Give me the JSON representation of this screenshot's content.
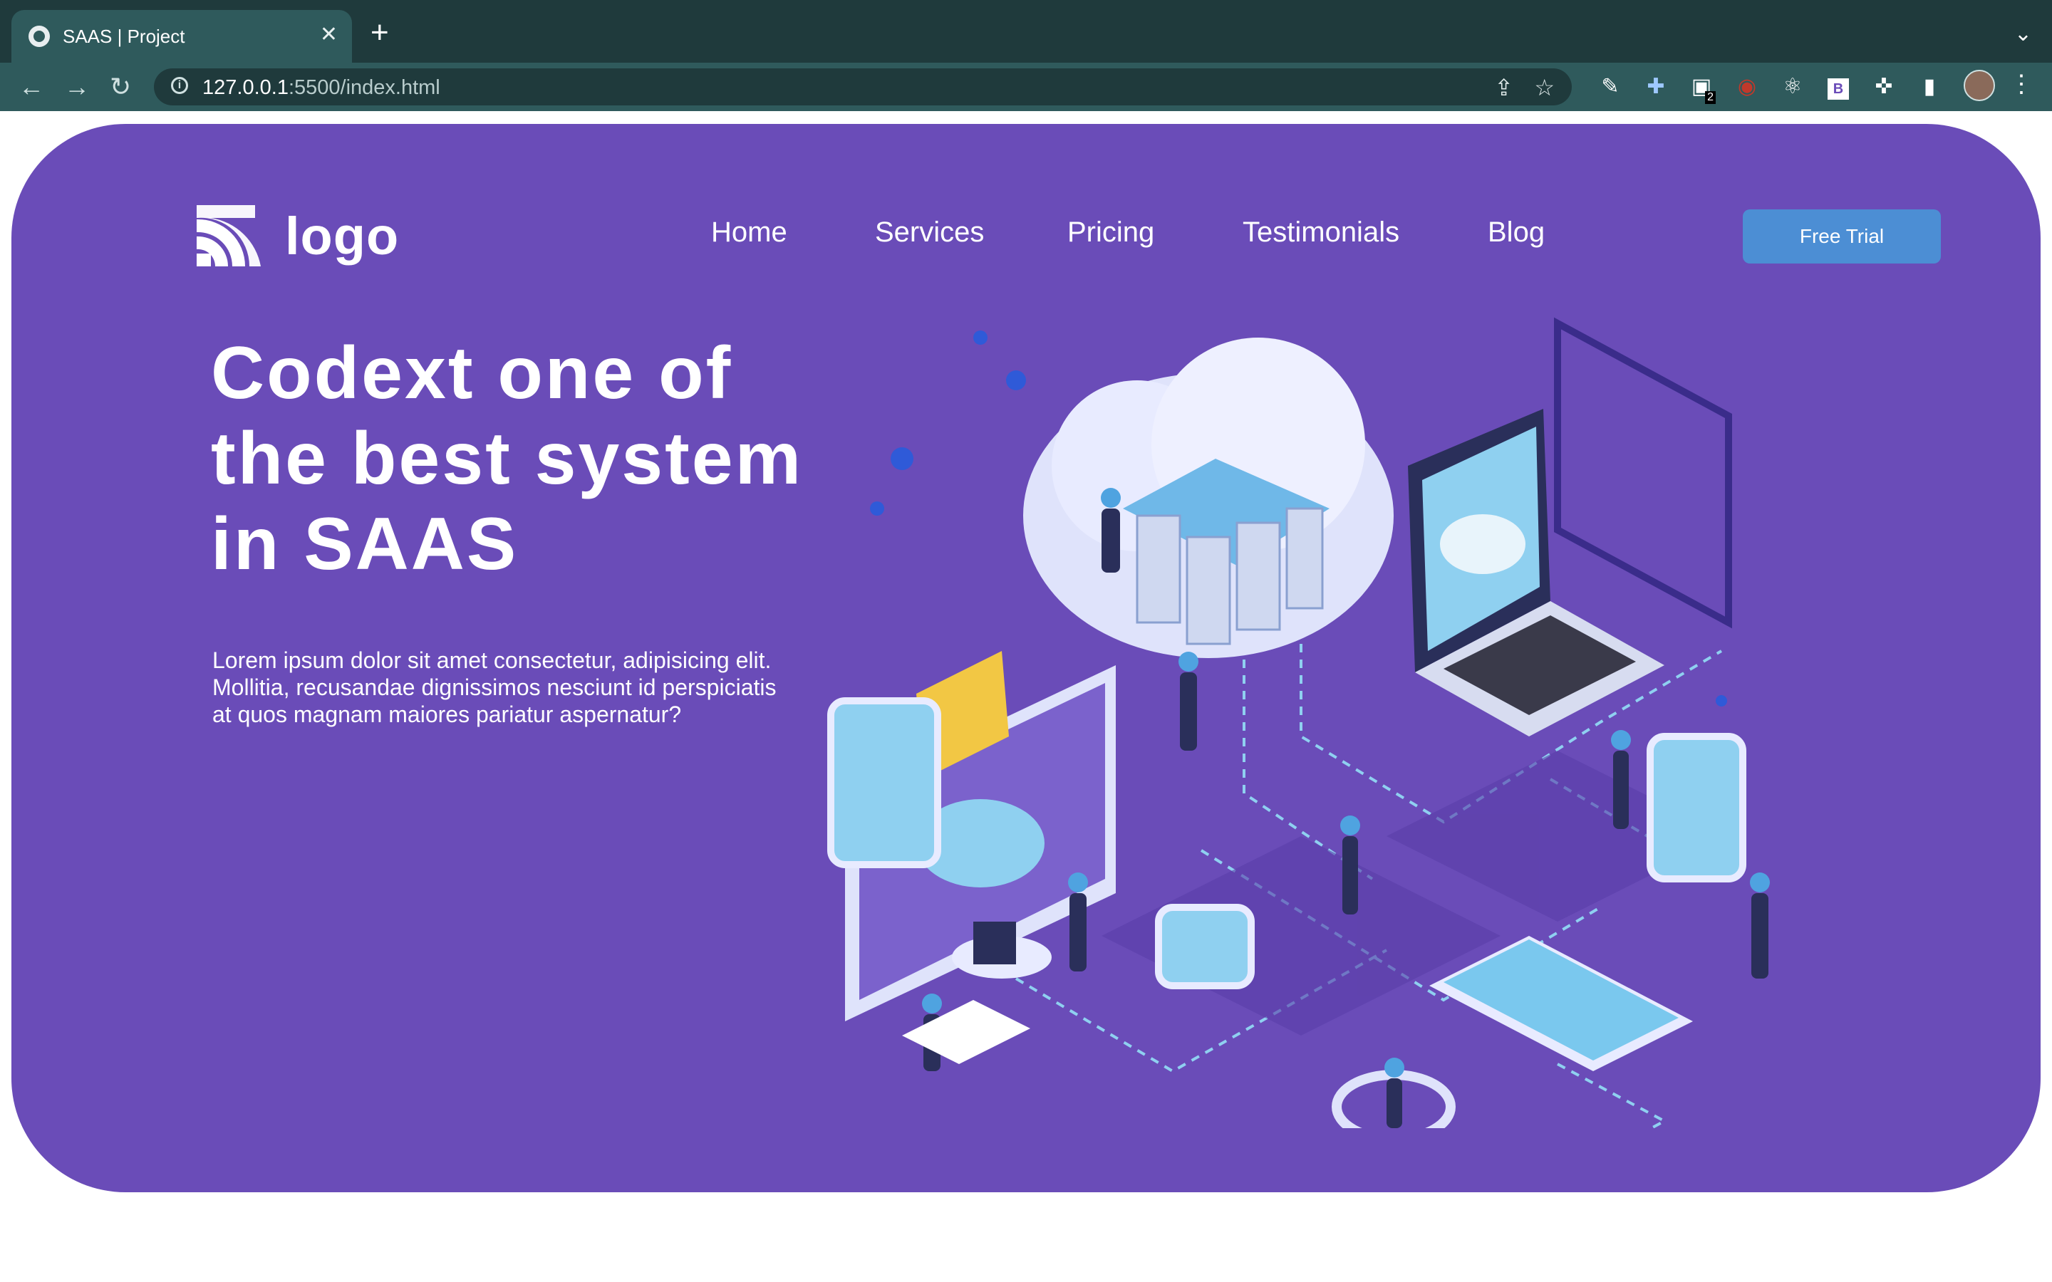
{
  "browser": {
    "tab_title": "SAAS | Project",
    "new_tab_label": "+",
    "url_host": "127.0.0.1",
    "url_rest": ":5500/index.html",
    "extension_badge_count": "2"
  },
  "brand": {
    "logo_text": "logo",
    "accent": "#6a4cb8",
    "button_color": "#4c8ed4"
  },
  "nav": {
    "items": [
      "Home",
      "Services",
      "Pricing",
      "Testimonials",
      "Blog"
    ],
    "cta_label": "Free Trial"
  },
  "hero": {
    "headline_lines": [
      "Codext one of",
      "the best system",
      "in SAAS"
    ],
    "lead_lines": [
      "Lorem ipsum dolor sit amet consectetur, adipisicing elit.",
      "Mollitia, recusandae dignissimos nesciunt id perspiciatis",
      "at quos magnam maiores pariatur aspernatur?"
    ]
  }
}
